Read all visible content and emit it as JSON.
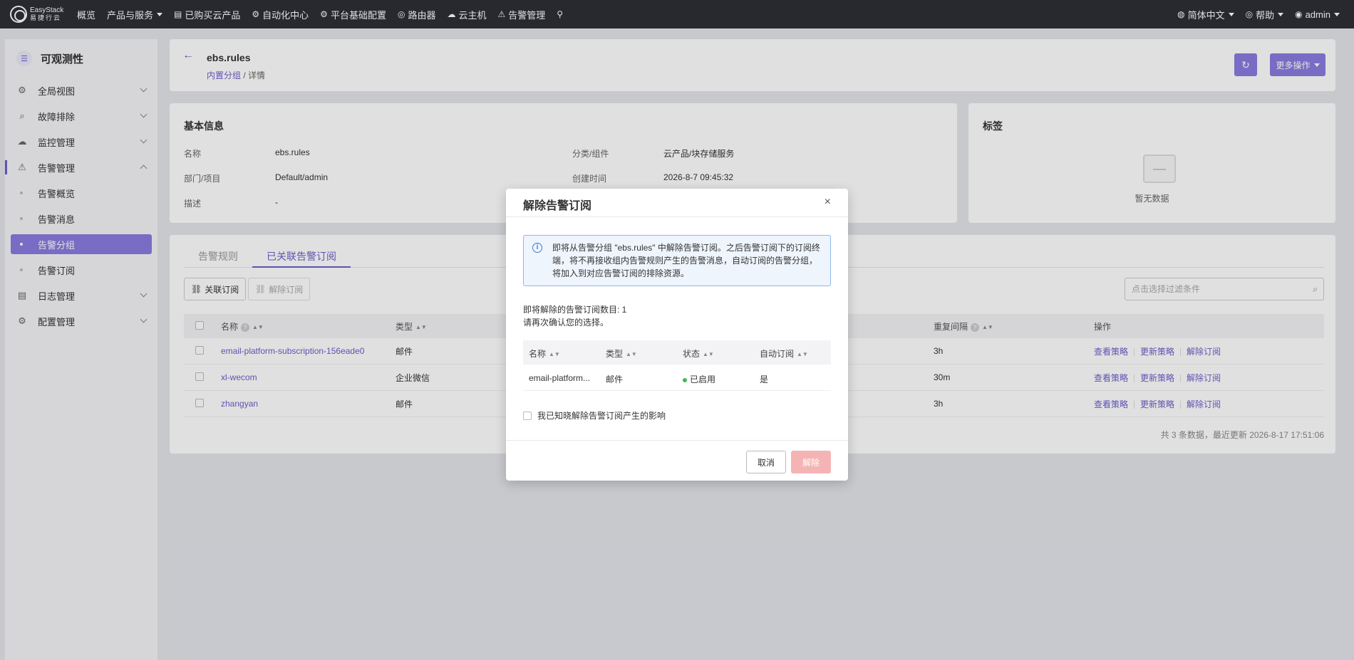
{
  "topbar": {
    "logo_brand": "EasyStack",
    "logo_sub": "易捷行云",
    "nav": [
      {
        "label": "概览",
        "icon": ""
      },
      {
        "label": "产品与服务",
        "icon": "",
        "dropdown": true
      },
      {
        "label": "已购买云产品",
        "icon": "▤"
      },
      {
        "label": "自动化中心",
        "icon": "⚙"
      },
      {
        "label": "平台基础配置",
        "icon": "⚙"
      },
      {
        "label": "路由器",
        "icon": "◎"
      },
      {
        "label": "云主机",
        "icon": "☁"
      },
      {
        "label": "告警管理",
        "icon": "⚠"
      }
    ],
    "language": "简体中文",
    "help": "帮助",
    "user": "admin"
  },
  "sidebar": {
    "title": "可观测性",
    "items": [
      {
        "label": "全局视图"
      },
      {
        "label": "故障排除"
      },
      {
        "label": "监控管理"
      },
      {
        "label": "告警管理"
      }
    ],
    "subitems": [
      "告警概览",
      "告警消息",
      "告警分组",
      "告警订阅"
    ],
    "items_after": [
      {
        "label": "日志管理"
      },
      {
        "label": "配置管理"
      }
    ]
  },
  "header": {
    "title": "ebs.rules",
    "breadcrumb_link": "内置分组",
    "breadcrumb_sep": " / ",
    "breadcrumb_current": "详情",
    "more_actions": "更多操作"
  },
  "basic_info": {
    "title": "基本信息",
    "name_label": "名称",
    "name_value": "ebs.rules",
    "category_label": "分类/组件",
    "category_value": "云产品/块存储服务",
    "dept_label": "部门/项目",
    "dept_value": "Default/admin",
    "created_label": "创建时间",
    "created_value": "2026-8-7 09:45:32",
    "desc_label": "描述",
    "desc_value": "-"
  },
  "tags": {
    "title": "标签",
    "empty": "暂无数据"
  },
  "list": {
    "tabs": [
      "告警规则",
      "已关联告警订阅"
    ],
    "btn_link": "关联订阅",
    "btn_unlink": "解除订阅",
    "search_placeholder": "点击选择过滤条件",
    "columns": {
      "name": "名称",
      "type": "类型",
      "interval": "重复间隔",
      "ops": "操作"
    },
    "rows": [
      {
        "name": "email-platform-subscription-156eade0",
        "type": "邮件",
        "interval": "3h"
      },
      {
        "name": "xl-wecom",
        "type": "企业微信",
        "interval": "30m"
      },
      {
        "name": "zhangyan",
        "type": "邮件",
        "interval": "3h"
      }
    ],
    "ops": [
      "查看策略",
      "更新策略",
      "解除订阅"
    ],
    "footer": "共 3 条数据，最近更新   2026-8-17 17:51:06"
  },
  "modal": {
    "title": "解除告警订阅",
    "alert_text": "即将从告警分组 \"ebs.rules\" 中解除告警订阅。之后告警订阅下的订阅终端，将不再接收组内告警规则产生的告警消息，自动订阅的告警分组，将加入到对应告警订阅的排除资源。",
    "count_text": "即将解除的告警订阅数目: 1",
    "confirm_text": "请再次确认您的选择。",
    "columns": {
      "name": "名称",
      "type": "类型",
      "status": "状态",
      "auto": "自动订阅"
    },
    "row": {
      "name": "email-platform...",
      "type": "邮件",
      "status": "已启用",
      "auto": "是"
    },
    "ack": "我已知晓解除告警订阅产生的影响",
    "cancel": "取消",
    "remove": "解除"
  }
}
